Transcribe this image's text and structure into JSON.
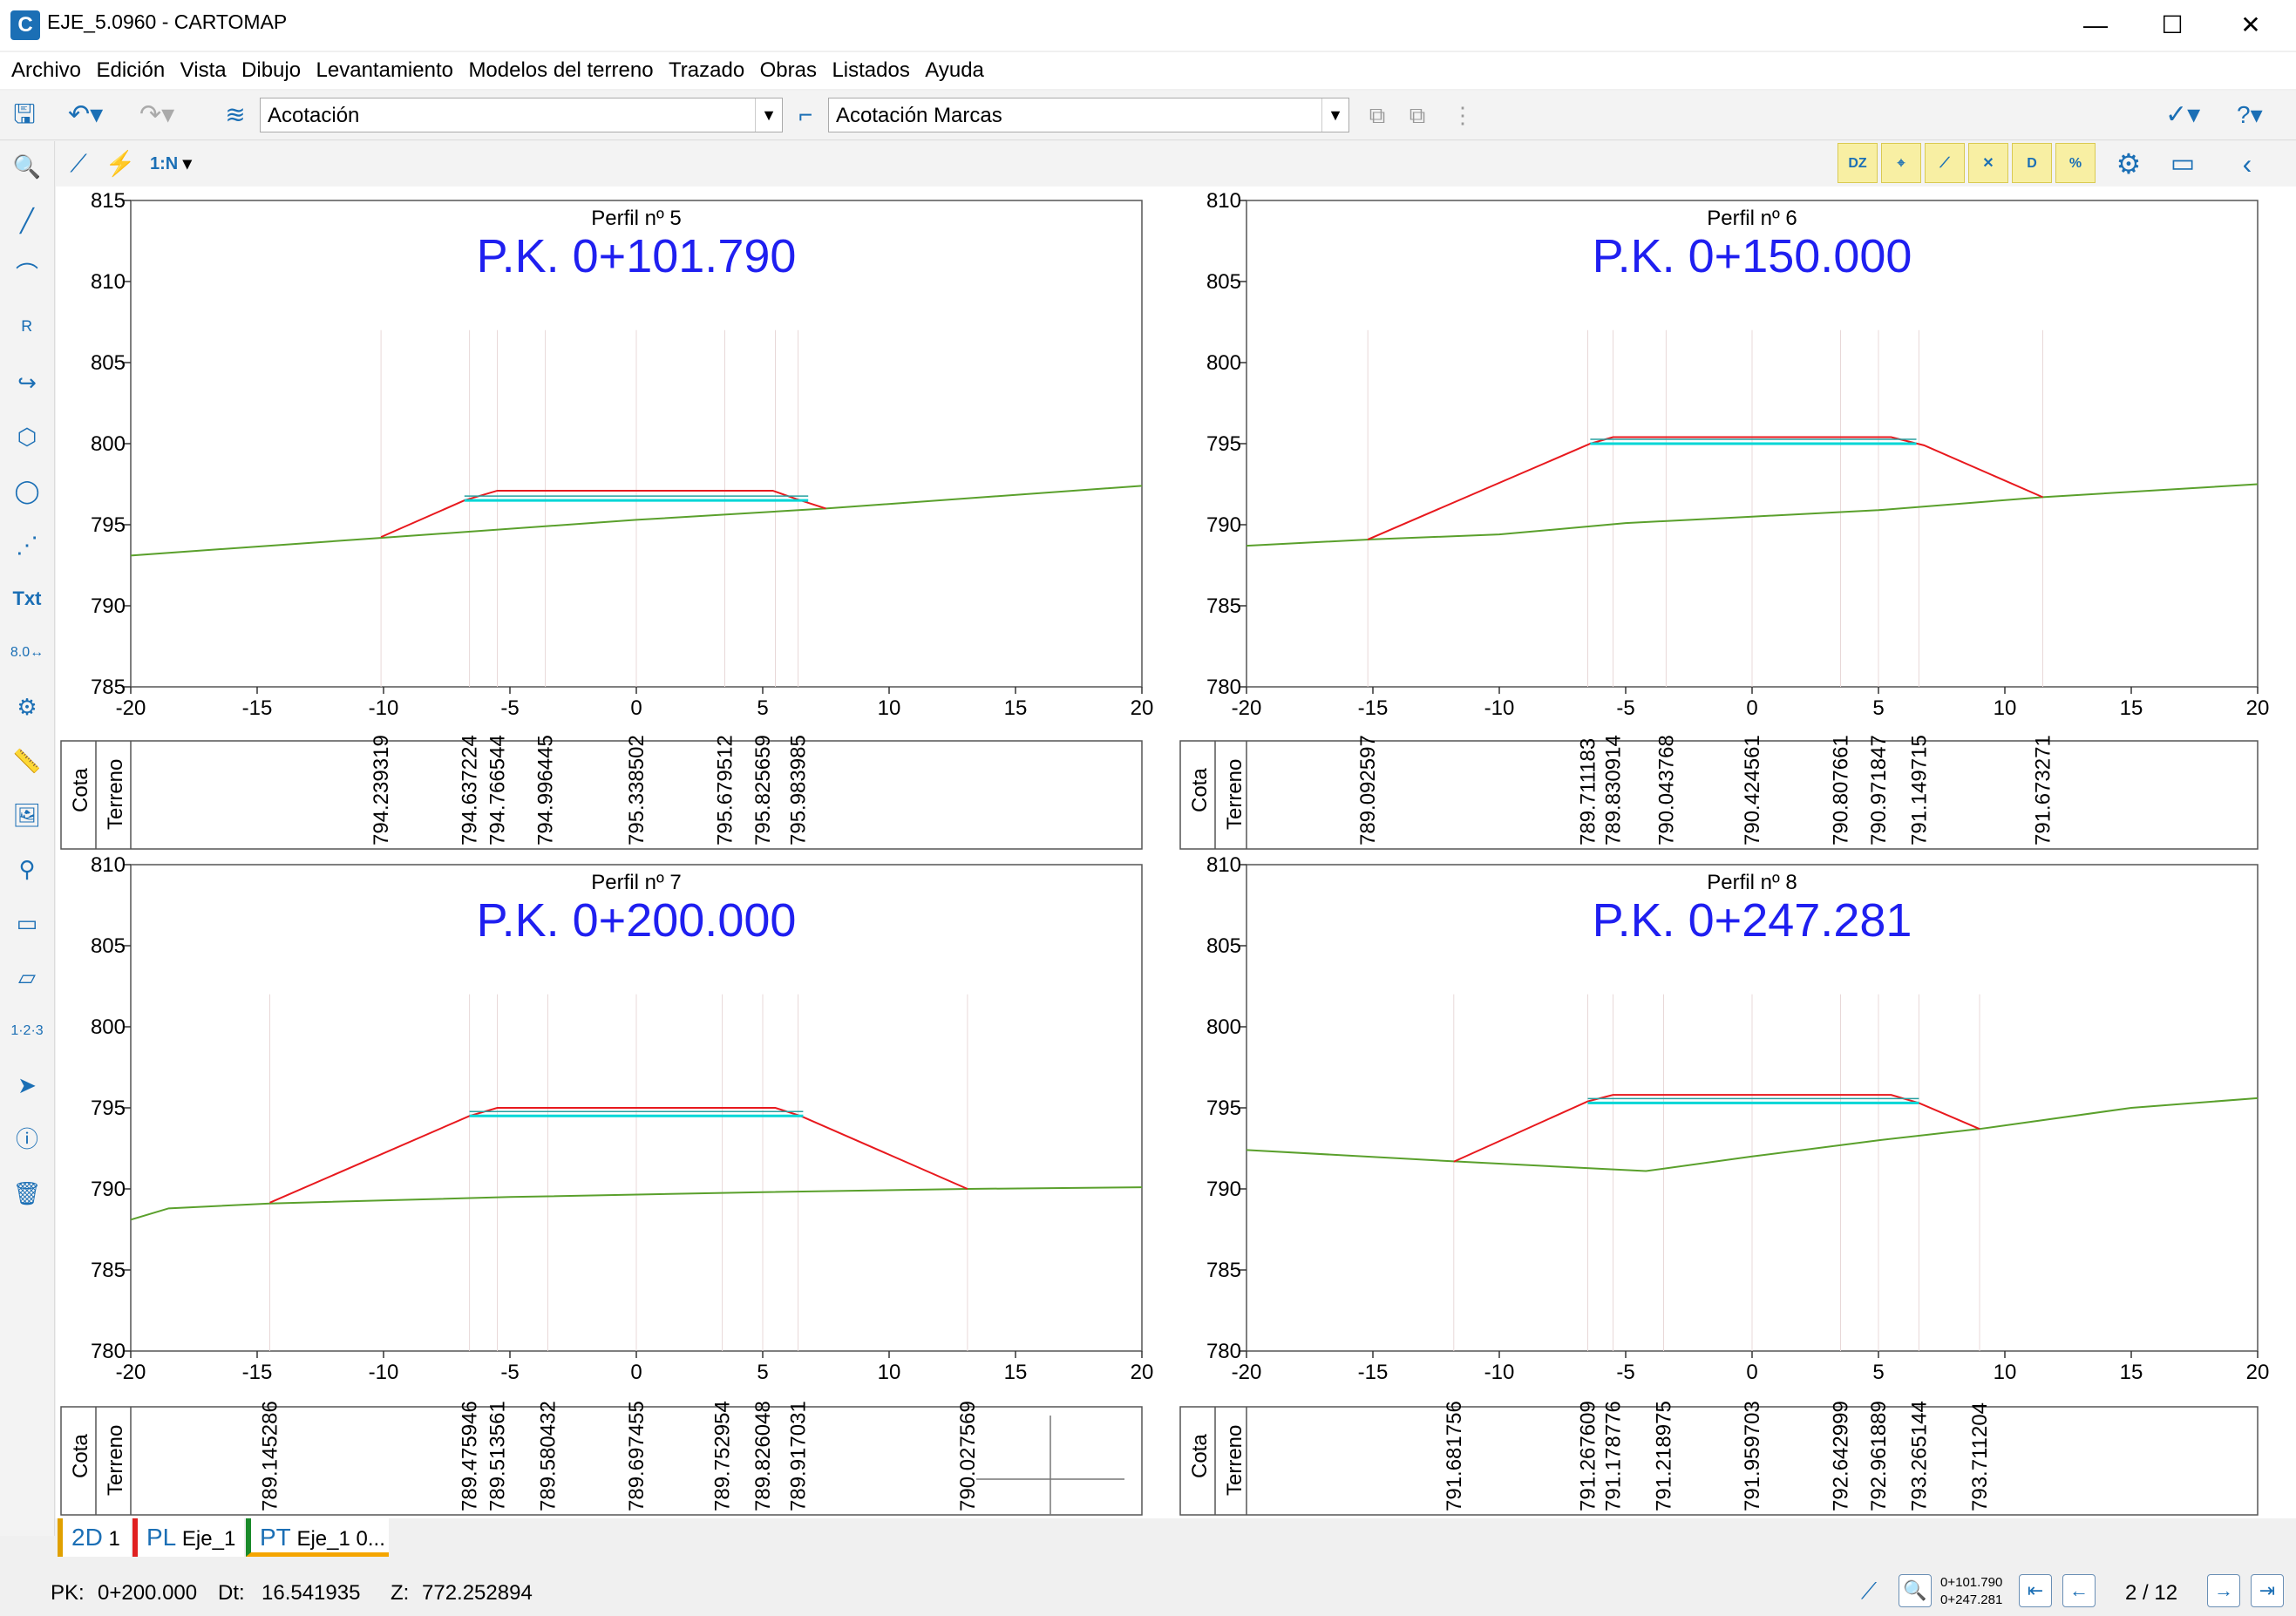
{
  "window": {
    "title": "EJE_5.0960 - CARTOMAP",
    "app_icon": "C"
  },
  "menu": [
    "Archivo",
    "Edición",
    "Vista",
    "Dibujo",
    "Levantamiento",
    "Modelos del terreno",
    "Trazado",
    "Obras",
    "Listados",
    "Ayuda"
  ],
  "toolbar": {
    "layer_combo": "Acotación",
    "style_combo": "Acotación Marcas",
    "scale_label": "1:N",
    "yellow_buttons": [
      "DZ",
      "",
      "",
      "",
      "D",
      "%"
    ]
  },
  "panels": [
    {
      "title": "Perfil nº 5",
      "pk": "P.K. 0+101.790",
      "yticks": [
        "815",
        "810",
        "805",
        "800",
        "795",
        "790",
        "785"
      ],
      "ymin": 785,
      "ymax": 815,
      "xticks": [
        "-20",
        "-15",
        "-10",
        "-5",
        "0",
        "5",
        "10",
        "15",
        "20"
      ],
      "terrain": [
        [
          -20,
          793.1
        ],
        [
          -10,
          794.2
        ],
        [
          0,
          795.3
        ],
        [
          7.5,
          796.0
        ],
        [
          20,
          797.4
        ]
      ],
      "road": [
        [
          -10.1,
          794.24
        ],
        [
          -6.8,
          796.5
        ],
        [
          -5.5,
          797.1
        ],
        [
          5.4,
          797.1
        ],
        [
          6.3,
          796.6
        ],
        [
          7.5,
          796.0
        ]
      ],
      "road_cyan": [
        [
          -6.8,
          796.5
        ],
        [
          6.8,
          796.5
        ]
      ],
      "marks": [
        -10.1,
        -6.6,
        -5.5,
        -3.6,
        0,
        3.5,
        5.5,
        6.4
      ],
      "labels_row": [
        "Cota",
        "Terreno"
      ],
      "labels": [
        {
          "x": -10.1,
          "text": "794.239319"
        },
        {
          "x": -6.6,
          "text": "794.637224"
        },
        {
          "x": -5.5,
          "text": "794.766544"
        },
        {
          "x": -3.6,
          "text": "794.996445"
        },
        {
          "x": 0,
          "text": "795.338502"
        },
        {
          "x": 3.5,
          "text": "795.679512"
        },
        {
          "x": 5.0,
          "text": "795.825659"
        },
        {
          "x": 6.4,
          "text": "795.983985"
        }
      ]
    },
    {
      "title": "Perfil nº 6",
      "pk": "P.K. 0+150.000",
      "yticks": [
        "810",
        "805",
        "800",
        "795",
        "790",
        "785",
        "780"
      ],
      "ymin": 780,
      "ymax": 810,
      "xticks": [
        "-20",
        "-15",
        "-10",
        "-5",
        "0",
        "5",
        "10",
        "15",
        "20"
      ],
      "terrain": [
        [
          -20,
          788.7
        ],
        [
          -15,
          789.1
        ],
        [
          -10,
          789.4
        ],
        [
          -5,
          790.1
        ],
        [
          0,
          790.5
        ],
        [
          5,
          790.9
        ],
        [
          11.5,
          791.7
        ],
        [
          20,
          792.5
        ]
      ],
      "road": [
        [
          -15.2,
          789.09
        ],
        [
          -6.4,
          795.0
        ],
        [
          -5.5,
          795.4
        ],
        [
          5.5,
          795.4
        ],
        [
          6.8,
          794.9
        ],
        [
          11.5,
          791.7
        ]
      ],
      "road_cyan": [
        [
          -6.4,
          795.0
        ],
        [
          6.5,
          795.0
        ]
      ],
      "marks": [
        -15.2,
        -6.5,
        -5.5,
        -3.4,
        0,
        3.5,
        5.0,
        6.6,
        11.5
      ],
      "labels_row": [
        "Cota",
        "Terreno"
      ],
      "labels": [
        {
          "x": -15.2,
          "text": "789.092597"
        },
        {
          "x": -6.5,
          "text": "789.711183"
        },
        {
          "x": -5.5,
          "text": "789.830914"
        },
        {
          "x": -3.4,
          "text": "790.043768"
        },
        {
          "x": 0,
          "text": "790.424561"
        },
        {
          "x": 3.5,
          "text": "790.807661"
        },
        {
          "x": 5.0,
          "text": "790.971847"
        },
        {
          "x": 6.6,
          "text": "791.149715"
        },
        {
          "x": 11.5,
          "text": "791.673271"
        }
      ]
    },
    {
      "title": "Perfil nº 7",
      "pk": "P.K. 0+200.000",
      "yticks": [
        "810",
        "805",
        "800",
        "795",
        "790",
        "785",
        "780"
      ],
      "ymin": 780,
      "ymax": 810,
      "xticks": [
        "-20",
        "-15",
        "-10",
        "-5",
        "0",
        "5",
        "10",
        "15",
        "20"
      ],
      "terrain": [
        [
          -20,
          788.1
        ],
        [
          -18.5,
          788.8
        ],
        [
          -14.5,
          789.1
        ],
        [
          -5,
          789.5
        ],
        [
          5,
          789.8
        ],
        [
          13.1,
          790.0
        ],
        [
          20,
          790.1
        ]
      ],
      "road": [
        [
          -14.5,
          789.15
        ],
        [
          -6.6,
          794.5
        ],
        [
          -5.5,
          795.0
        ],
        [
          5.5,
          795.0
        ],
        [
          6.5,
          794.5
        ],
        [
          13.1,
          790.0
        ]
      ],
      "road_cyan": [
        [
          -6.6,
          794.5
        ],
        [
          6.6,
          794.5
        ]
      ],
      "marks": [
        -14.5,
        -6.6,
        -5.5,
        -3.5,
        0,
        3.4,
        5.0,
        6.4,
        13.1
      ],
      "labels_row": [
        "Cota",
        "Terreno"
      ],
      "labels": [
        {
          "x": -14.5,
          "text": "789.145286"
        },
        {
          "x": -6.6,
          "text": "789.475946"
        },
        {
          "x": -5.5,
          "text": "789.513561"
        },
        {
          "x": -3.5,
          "text": "789.580432"
        },
        {
          "x": 0,
          "text": "789.697455"
        },
        {
          "x": 3.4,
          "text": "789.752954"
        },
        {
          "x": 5.0,
          "text": "789.826048"
        },
        {
          "x": 6.4,
          "text": "789.917031"
        },
        {
          "x": 13.1,
          "text": "790.027569"
        }
      ]
    },
    {
      "title": "Perfil nº 8",
      "pk": "P.K. 0+247.281",
      "yticks": [
        "810",
        "805",
        "800",
        "795",
        "790",
        "785",
        "780"
      ],
      "ymin": 780,
      "ymax": 810,
      "xticks": [
        "-20",
        "-15",
        "-10",
        "-5",
        "0",
        "5",
        "10",
        "15",
        "20"
      ],
      "terrain": [
        [
          -20,
          792.4
        ],
        [
          -11.8,
          791.7
        ],
        [
          -4.2,
          791.1
        ],
        [
          0,
          792.0
        ],
        [
          5,
          793.0
        ],
        [
          9,
          793.7
        ],
        [
          15,
          795.0
        ],
        [
          20,
          795.6
        ]
      ],
      "road": [
        [
          -11.8,
          791.68
        ],
        [
          -6.5,
          795.4
        ],
        [
          -5.5,
          795.8
        ],
        [
          5.5,
          795.8
        ],
        [
          6.6,
          795.3
        ],
        [
          9.0,
          793.7
        ]
      ],
      "road_cyan": [
        [
          -6.5,
          795.3
        ],
        [
          6.6,
          795.3
        ]
      ],
      "marks": [
        -11.8,
        -6.5,
        -5.5,
        -3.5,
        0,
        3.5,
        5.0,
        6.6,
        9.0
      ],
      "labels_row": [
        "Cota",
        "Terreno"
      ],
      "labels": [
        {
          "x": -11.8,
          "text": "791.681756"
        },
        {
          "x": -6.5,
          "text": "791.267609"
        },
        {
          "x": -5.5,
          "text": "791.178776"
        },
        {
          "x": -3.5,
          "text": "791.218975"
        },
        {
          "x": 0,
          "text": "791.959703"
        },
        {
          "x": 3.5,
          "text": "792.642999"
        },
        {
          "x": 5.0,
          "text": "792.961889"
        },
        {
          "x": 6.6,
          "text": "793.265144"
        },
        {
          "x": 9.0,
          "text": "793.711204"
        }
      ]
    }
  ],
  "colors": {
    "terrain": "#5aa02c",
    "road": "#e8191e",
    "road_inner": "#00d6d6",
    "pk_text": "#1f1ff0",
    "accent": "#1b6fb5"
  },
  "tabs": [
    {
      "code": "2D",
      "label": "1",
      "color": "#e0a000"
    },
    {
      "code": "PL",
      "label": "Eje_1",
      "color": "#e02020"
    },
    {
      "code": "PT",
      "label": "Eje_1 0...",
      "color": "#1a8a2a"
    }
  ],
  "status": {
    "pk_label": "PK:",
    "pk_value": "0+200.000",
    "dt_label": "Dt:",
    "dt_value": "16.541935",
    "z_label": "Z:",
    "z_value": "772.252894",
    "range_top": "0+101.790",
    "range_bottom": "0+247.281",
    "page": "2 / 12"
  }
}
